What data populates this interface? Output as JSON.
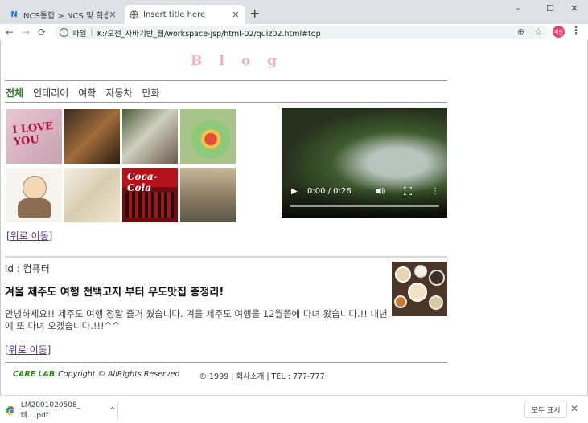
{
  "browser": {
    "tabs": [
      {
        "title": "NCS통합 > NCS 및 학습모듈검",
        "favicon": "N",
        "active": false
      },
      {
        "title": "Insert title here",
        "favicon": "globe",
        "active": true
      }
    ],
    "new_tab": "+",
    "address": {
      "scheme_label": "파일",
      "path": "K:/오전_자바기반_웹/workspace-jsp/html-02/quiz02.html#top"
    },
    "avatar_text": "파인",
    "window_controls": [
      "–",
      "☐",
      "✕"
    ]
  },
  "page": {
    "blog_title": "Blog",
    "menu": [
      {
        "label": "전체",
        "active": true
      },
      {
        "label": "인테리어",
        "active": false
      },
      {
        "label": "여학",
        "active": false
      },
      {
        "label": "자동차",
        "active": false
      },
      {
        "label": "만화",
        "active": false
      }
    ],
    "thumbnails": [
      {
        "label": "I LOVE YOU"
      },
      {
        "label": ""
      },
      {
        "label": ""
      },
      {
        "label": ""
      },
      {
        "label": ""
      },
      {
        "label": ""
      },
      {
        "label": "Coca-Cola"
      },
      {
        "label": ""
      }
    ],
    "video": {
      "time": "0:00 / 0:26",
      "progress": 0
    },
    "top_link": "[위로 이동]",
    "article": {
      "id_line": "id : 컴퓨터",
      "title": "겨울 제주도 여행 천백고지 부터 우도맛집 총정리!",
      "body": "안녕하세요!! 제주도 여행 정말 즐거 웠습니다. 겨울 제주도 여행을 12월쯤에 다녀 왔습니다.!! 내년에 또 다녀 오겠습니다.!!!^^",
      "top_link": "[위로 이동]"
    },
    "footer": {
      "brand": "CARE LAB",
      "copyright": "Copyright © AllRights Reserved",
      "info": "® 1999 | 회사소개 | TEL : 777-777"
    }
  },
  "download_bar": {
    "filename": "LM2001020508_테....pdf",
    "show_all": "모두 표시",
    "close": "✕"
  }
}
